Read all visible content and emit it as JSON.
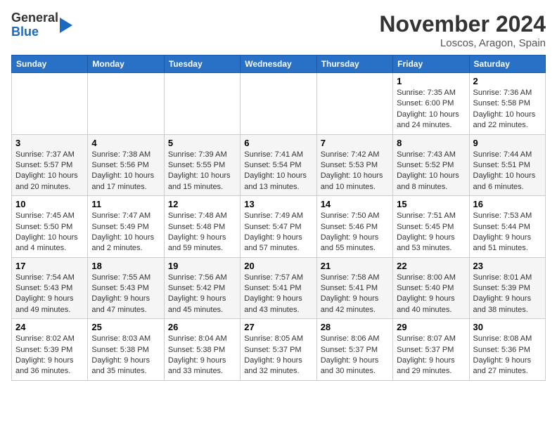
{
  "header": {
    "logo_line1": "General",
    "logo_line2": "Blue",
    "month_title": "November 2024",
    "location": "Loscos, Aragon, Spain"
  },
  "calendar": {
    "days_of_week": [
      "Sunday",
      "Monday",
      "Tuesday",
      "Wednesday",
      "Thursday",
      "Friday",
      "Saturday"
    ],
    "weeks": [
      [
        {
          "day": "",
          "info": ""
        },
        {
          "day": "",
          "info": ""
        },
        {
          "day": "",
          "info": ""
        },
        {
          "day": "",
          "info": ""
        },
        {
          "day": "",
          "info": ""
        },
        {
          "day": "1",
          "info": "Sunrise: 7:35 AM\nSunset: 6:00 PM\nDaylight: 10 hours and 24 minutes."
        },
        {
          "day": "2",
          "info": "Sunrise: 7:36 AM\nSunset: 5:58 PM\nDaylight: 10 hours and 22 minutes."
        }
      ],
      [
        {
          "day": "3",
          "info": "Sunrise: 7:37 AM\nSunset: 5:57 PM\nDaylight: 10 hours and 20 minutes."
        },
        {
          "day": "4",
          "info": "Sunrise: 7:38 AM\nSunset: 5:56 PM\nDaylight: 10 hours and 17 minutes."
        },
        {
          "day": "5",
          "info": "Sunrise: 7:39 AM\nSunset: 5:55 PM\nDaylight: 10 hours and 15 minutes."
        },
        {
          "day": "6",
          "info": "Sunrise: 7:41 AM\nSunset: 5:54 PM\nDaylight: 10 hours and 13 minutes."
        },
        {
          "day": "7",
          "info": "Sunrise: 7:42 AM\nSunset: 5:53 PM\nDaylight: 10 hours and 10 minutes."
        },
        {
          "day": "8",
          "info": "Sunrise: 7:43 AM\nSunset: 5:52 PM\nDaylight: 10 hours and 8 minutes."
        },
        {
          "day": "9",
          "info": "Sunrise: 7:44 AM\nSunset: 5:51 PM\nDaylight: 10 hours and 6 minutes."
        }
      ],
      [
        {
          "day": "10",
          "info": "Sunrise: 7:45 AM\nSunset: 5:50 PM\nDaylight: 10 hours and 4 minutes."
        },
        {
          "day": "11",
          "info": "Sunrise: 7:47 AM\nSunset: 5:49 PM\nDaylight: 10 hours and 2 minutes."
        },
        {
          "day": "12",
          "info": "Sunrise: 7:48 AM\nSunset: 5:48 PM\nDaylight: 9 hours and 59 minutes."
        },
        {
          "day": "13",
          "info": "Sunrise: 7:49 AM\nSunset: 5:47 PM\nDaylight: 9 hours and 57 minutes."
        },
        {
          "day": "14",
          "info": "Sunrise: 7:50 AM\nSunset: 5:46 PM\nDaylight: 9 hours and 55 minutes."
        },
        {
          "day": "15",
          "info": "Sunrise: 7:51 AM\nSunset: 5:45 PM\nDaylight: 9 hours and 53 minutes."
        },
        {
          "day": "16",
          "info": "Sunrise: 7:53 AM\nSunset: 5:44 PM\nDaylight: 9 hours and 51 minutes."
        }
      ],
      [
        {
          "day": "17",
          "info": "Sunrise: 7:54 AM\nSunset: 5:43 PM\nDaylight: 9 hours and 49 minutes."
        },
        {
          "day": "18",
          "info": "Sunrise: 7:55 AM\nSunset: 5:43 PM\nDaylight: 9 hours and 47 minutes."
        },
        {
          "day": "19",
          "info": "Sunrise: 7:56 AM\nSunset: 5:42 PM\nDaylight: 9 hours and 45 minutes."
        },
        {
          "day": "20",
          "info": "Sunrise: 7:57 AM\nSunset: 5:41 PM\nDaylight: 9 hours and 43 minutes."
        },
        {
          "day": "21",
          "info": "Sunrise: 7:58 AM\nSunset: 5:41 PM\nDaylight: 9 hours and 42 minutes."
        },
        {
          "day": "22",
          "info": "Sunrise: 8:00 AM\nSunset: 5:40 PM\nDaylight: 9 hours and 40 minutes."
        },
        {
          "day": "23",
          "info": "Sunrise: 8:01 AM\nSunset: 5:39 PM\nDaylight: 9 hours and 38 minutes."
        }
      ],
      [
        {
          "day": "24",
          "info": "Sunrise: 8:02 AM\nSunset: 5:39 PM\nDaylight: 9 hours and 36 minutes."
        },
        {
          "day": "25",
          "info": "Sunrise: 8:03 AM\nSunset: 5:38 PM\nDaylight: 9 hours and 35 minutes."
        },
        {
          "day": "26",
          "info": "Sunrise: 8:04 AM\nSunset: 5:38 PM\nDaylight: 9 hours and 33 minutes."
        },
        {
          "day": "27",
          "info": "Sunrise: 8:05 AM\nSunset: 5:37 PM\nDaylight: 9 hours and 32 minutes."
        },
        {
          "day": "28",
          "info": "Sunrise: 8:06 AM\nSunset: 5:37 PM\nDaylight: 9 hours and 30 minutes."
        },
        {
          "day": "29",
          "info": "Sunrise: 8:07 AM\nSunset: 5:37 PM\nDaylight: 9 hours and 29 minutes."
        },
        {
          "day": "30",
          "info": "Sunrise: 8:08 AM\nSunset: 5:36 PM\nDaylight: 9 hours and 27 minutes."
        }
      ]
    ]
  }
}
